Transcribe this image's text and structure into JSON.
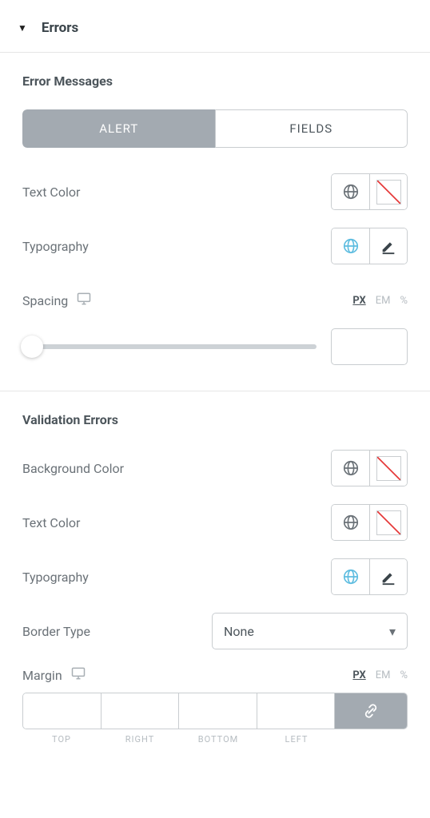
{
  "section": {
    "title": "Errors"
  },
  "error_messages": {
    "title": "Error Messages",
    "tabs": {
      "alert": "ALERT",
      "fields": "FIELDS"
    },
    "text_color_label": "Text Color",
    "typography_label": "Typography",
    "spacing_label": "Spacing",
    "spacing_value": "",
    "units": {
      "px": "PX",
      "em": "EM",
      "pct": "%"
    }
  },
  "validation_errors": {
    "title": "Validation Errors",
    "background_color_label": "Background Color",
    "text_color_label": "Text Color",
    "typography_label": "Typography",
    "border_type_label": "Border Type",
    "border_type_value": "None",
    "margin_label": "Margin",
    "margin_values": {
      "top": "",
      "right": "",
      "bottom": "",
      "left": ""
    },
    "margin_sides": {
      "top": "TOP",
      "right": "RIGHT",
      "bottom": "BOTTOM",
      "left": "LEFT"
    },
    "units": {
      "px": "PX",
      "em": "EM",
      "pct": "%"
    }
  }
}
